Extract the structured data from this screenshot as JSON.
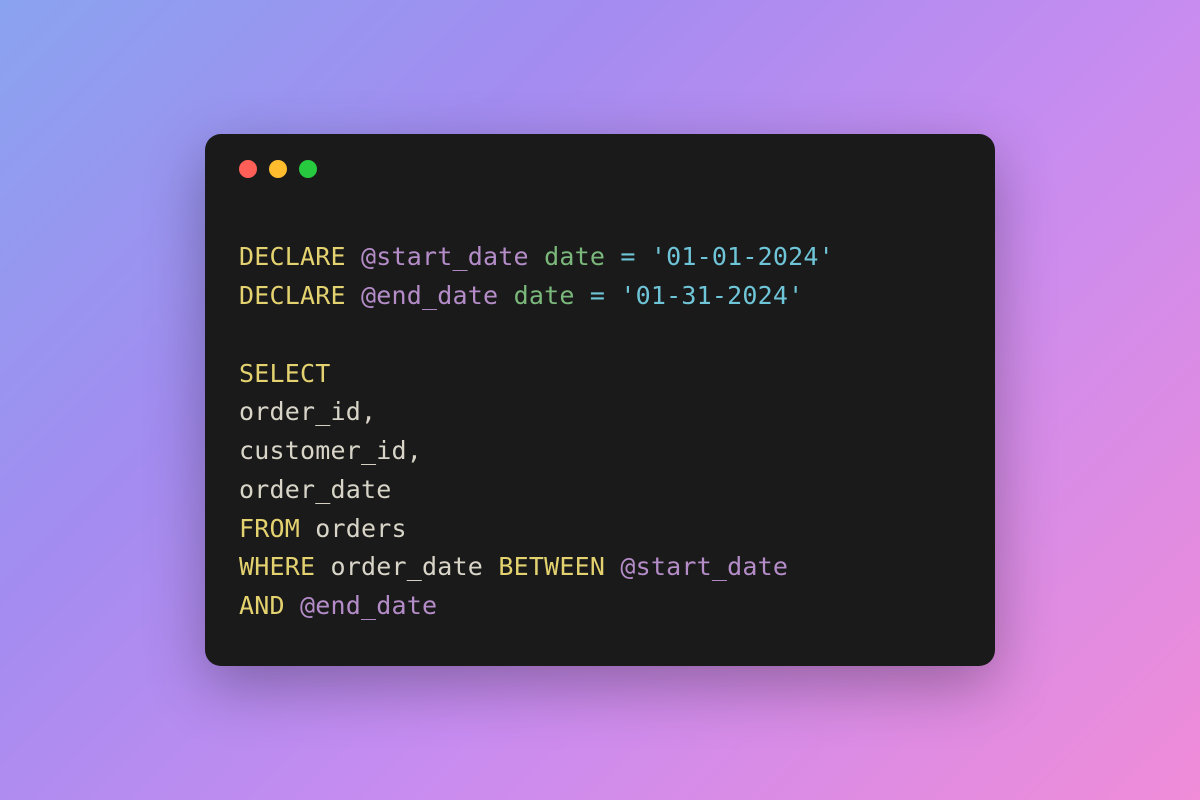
{
  "colors": {
    "window_bg": "#1a1a1a",
    "traffic_red": "#ff5f56",
    "traffic_yellow": "#ffbd2e",
    "traffic_green": "#27c93f",
    "keyword": "#e3d26f",
    "variable": "#b48cc8",
    "type": "#7bb87b",
    "operator": "#6fc5d8",
    "string": "#6fc5d8",
    "identifier": "#d8d5c8"
  },
  "code": {
    "lines": [
      [
        {
          "t": "DECLARE",
          "c": "kw"
        },
        {
          "t": " ",
          "c": "ident"
        },
        {
          "t": "@start_date",
          "c": "var"
        },
        {
          "t": " ",
          "c": "ident"
        },
        {
          "t": "date",
          "c": "type"
        },
        {
          "t": " ",
          "c": "ident"
        },
        {
          "t": "=",
          "c": "op"
        },
        {
          "t": " ",
          "c": "ident"
        },
        {
          "t": "'01-01-2024'",
          "c": "str"
        }
      ],
      [
        {
          "t": "DECLARE",
          "c": "kw"
        },
        {
          "t": " ",
          "c": "ident"
        },
        {
          "t": "@end_date",
          "c": "var"
        },
        {
          "t": " ",
          "c": "ident"
        },
        {
          "t": "date",
          "c": "type"
        },
        {
          "t": " ",
          "c": "ident"
        },
        {
          "t": "=",
          "c": "op"
        },
        {
          "t": " ",
          "c": "ident"
        },
        {
          "t": "'01-31-2024'",
          "c": "str"
        }
      ],
      [],
      [
        {
          "t": "SELECT",
          "c": "kw"
        }
      ],
      [
        {
          "t": "order_id,",
          "c": "ident"
        }
      ],
      [
        {
          "t": "customer_id,",
          "c": "ident"
        }
      ],
      [
        {
          "t": "order_date",
          "c": "ident"
        }
      ],
      [
        {
          "t": "FROM",
          "c": "kw"
        },
        {
          "t": " ",
          "c": "ident"
        },
        {
          "t": "orders",
          "c": "ident"
        }
      ],
      [
        {
          "t": "WHERE",
          "c": "kw"
        },
        {
          "t": " ",
          "c": "ident"
        },
        {
          "t": "order_date",
          "c": "ident"
        },
        {
          "t": " ",
          "c": "ident"
        },
        {
          "t": "BETWEEN",
          "c": "kw"
        },
        {
          "t": " ",
          "c": "ident"
        },
        {
          "t": "@start_date",
          "c": "var"
        }
      ],
      [
        {
          "t": "AND",
          "c": "kw"
        },
        {
          "t": " ",
          "c": "ident"
        },
        {
          "t": "@end_date",
          "c": "var"
        }
      ]
    ]
  }
}
